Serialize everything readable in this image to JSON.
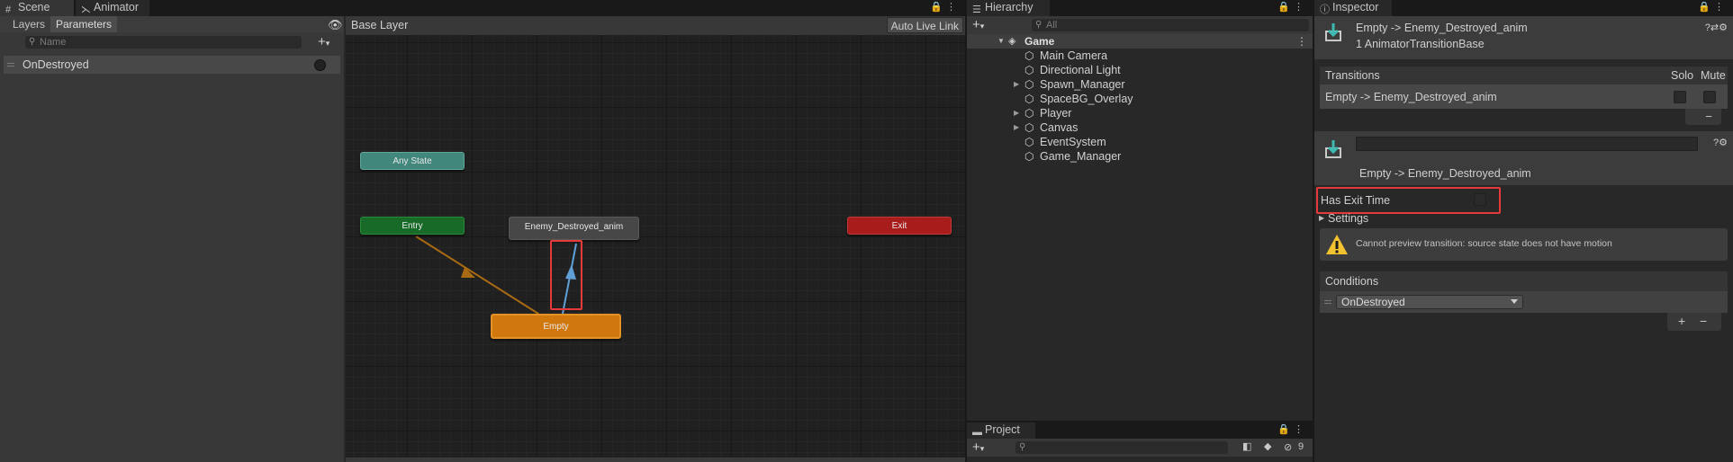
{
  "animator": {
    "tabs": {
      "scene": "Scene",
      "animator": "Animator"
    },
    "subtabs": {
      "layers": "Layers",
      "parameters": "Parameters"
    },
    "search_placeholder": "Name",
    "parameters": [
      {
        "name": "OnDestroyed"
      }
    ],
    "graph": {
      "breadcrumb": "Base Layer",
      "auto_live_link": "Auto Live Link",
      "nodes": {
        "any_state": "Any State",
        "entry": "Entry",
        "enemy_destroyed": "Enemy_Destroyed_anim",
        "exit": "Exit",
        "empty": "Empty"
      }
    }
  },
  "hierarchy": {
    "tab": "Hierarchy",
    "search_placeholder": "All",
    "scene_name": "Game",
    "items": [
      {
        "name": "Main Camera",
        "expandable": false
      },
      {
        "name": "Directional Light",
        "expandable": false
      },
      {
        "name": "Spawn_Manager",
        "expandable": true
      },
      {
        "name": "SpaceBG_Overlay",
        "expandable": false
      },
      {
        "name": "Player",
        "expandable": true
      },
      {
        "name": "Canvas",
        "expandable": true
      },
      {
        "name": "EventSystem",
        "expandable": false
      },
      {
        "name": "Game_Manager",
        "expandable": false
      }
    ]
  },
  "project": {
    "tab": "Project",
    "hidden_count": "9"
  },
  "inspector": {
    "tab": "Inspector",
    "title": "Empty -> Enemy_Destroyed_anim",
    "subtitle": "1 AnimatorTransitionBase",
    "transitions": {
      "header": "Transitions",
      "solo": "Solo",
      "mute": "Mute",
      "row": "Empty -> Enemy_Destroyed_anim"
    },
    "transition_name": "Empty -> Enemy_Destroyed_anim",
    "has_exit_time": "Has Exit Time",
    "settings": "Settings",
    "warning": "Cannot preview transition: source state does not have motion",
    "conditions": {
      "header": "Conditions",
      "value": "OnDestroyed"
    },
    "colors": {
      "highlight": "#e8393a",
      "warning": "#f2c230"
    }
  }
}
